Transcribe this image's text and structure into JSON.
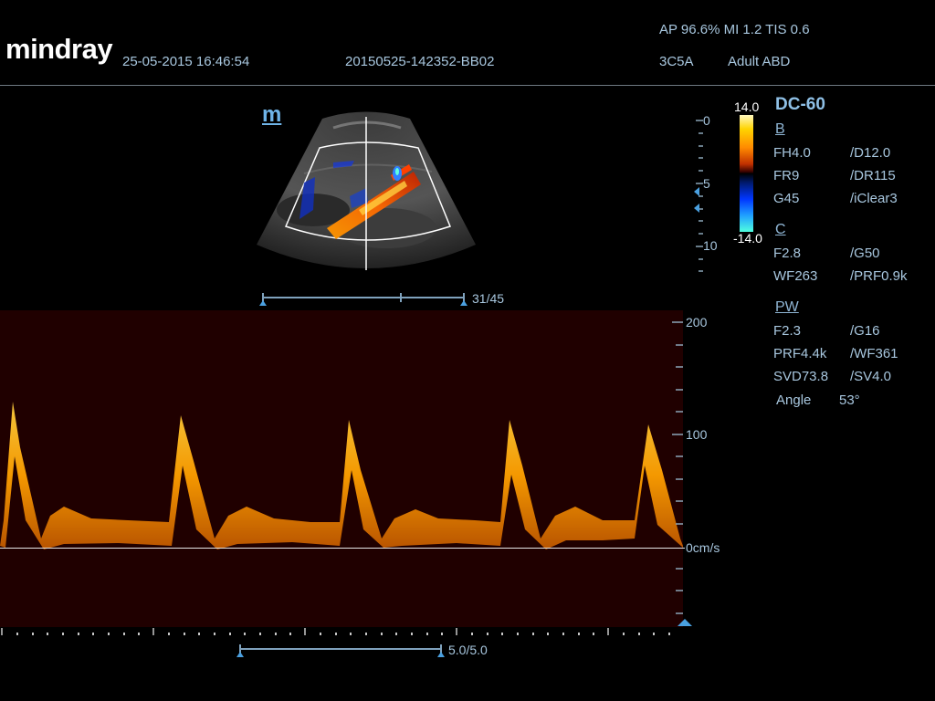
{
  "header": {
    "logo": "mindray",
    "datetime": "25-05-2015 16:46:54",
    "exam_id": "20150525-142352-BB02",
    "acoustic": "AP 96.6%  MI 1.2 TIS 0.6",
    "probe": "3C5A",
    "exam_mode": "Adult ABD"
  },
  "image_marker": "m",
  "depth_scale": {
    "labels": [
      "0",
      "5",
      "10"
    ]
  },
  "color_bar": {
    "max": "14.0",
    "min": "-14.0"
  },
  "panel": {
    "preset": "DC-60",
    "b": {
      "title": "B",
      "rows": [
        [
          "FH4.0",
          "/D12.0"
        ],
        [
          "FR9",
          "/DR115"
        ],
        [
          "G45",
          "/iClear3"
        ]
      ]
    },
    "c": {
      "title": "C",
      "rows": [
        [
          "F2.8",
          "/G50"
        ],
        [
          "WF263",
          "/PRF0.9k"
        ]
      ]
    },
    "pw": {
      "title": "PW",
      "rows": [
        [
          "F2.3",
          "/G16"
        ],
        [
          "PRF4.4k",
          "/WF361"
        ],
        [
          "SVD73.8",
          "/SV4.0"
        ]
      ]
    },
    "angle_label": "Angle",
    "angle_value": "53°"
  },
  "cine_top": {
    "frames": "31/45"
  },
  "cine_bottom": {
    "speed": "5.0/5.0"
  },
  "velocity_scale": {
    "labels": [
      "200",
      "100",
      "0cm/s"
    ]
  },
  "colors": {
    "text": "#a8c7df",
    "accent": "#8fc0e6",
    "doppler": "#ffb000"
  }
}
